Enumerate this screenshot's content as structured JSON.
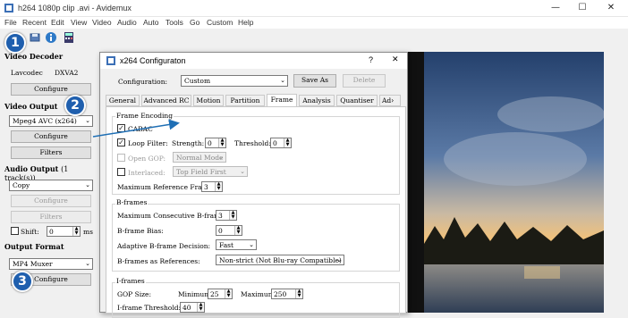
{
  "window": {
    "title": "h264 1080p clip .avi - Avidemux",
    "min": "—",
    "max": "☐",
    "close": "✕"
  },
  "menu": [
    "File",
    "Recent",
    "Edit",
    "View",
    "Video",
    "Audio",
    "Auto",
    "Tools",
    "Go",
    "Custom",
    "Help"
  ],
  "left": {
    "video_decoder": {
      "title": "Video Decoder",
      "codec_label": "Lavcodec",
      "codec_value": "DXVA2",
      "configure": "Configure"
    },
    "video_output": {
      "title": "Video Output",
      "codec": "Mpeg4 AVC (x264)",
      "configure": "Configure",
      "filters": "Filters"
    },
    "audio_output": {
      "title": "Audio Output",
      "tracks": "(1 track(s))",
      "codec": "Copy",
      "configure": "Configure",
      "filters": "Filters",
      "shift_label": "Shift:",
      "shift_value": "0",
      "shift_unit": "ms"
    },
    "output_format": {
      "title": "Output Format",
      "muxer": "MP4 Muxer",
      "configure": "Configure"
    }
  },
  "badges": [
    "1",
    "2",
    "3"
  ],
  "dialog": {
    "title": "x264 Configuraton",
    "help": "?",
    "close": "✕",
    "config_label": "Configuration:",
    "config_value": "Custom",
    "save_as": "Save As",
    "delete": "Delete",
    "tabs": [
      "General",
      "Advanced RC",
      "Motion",
      "Partition",
      "Frame",
      "Analysis",
      "Quantiser",
      "Ad"
    ],
    "active_tab": "Frame",
    "frame_encoding": {
      "title": "Frame Encoding",
      "cabac": "CABAC",
      "loop_filter": "Loop Filter:",
      "strength_label": "Strength:",
      "strength_value": "0",
      "threshold_label": "Threshold:",
      "threshold_value": "0",
      "open_gop": "Open GOP:",
      "open_gop_value": "Normal Mode",
      "interlaced": "Interlaced:",
      "interlaced_value": "Top Field First",
      "max_ref_label": "Maximum Reference Frames:",
      "max_ref_value": "3"
    },
    "bframes": {
      "title": "B-frames",
      "max_consec_label": "Maximum Consecutive B-frames:",
      "max_consec_value": "3",
      "bias_label": "B-frame Bias:",
      "bias_value": "0",
      "adaptive_label": "Adaptive B-frame Decision:",
      "adaptive_value": "Fast",
      "refs_label": "B-frames as References:",
      "refs_value": "Non-strict (Not Blu-ray Compatible)"
    },
    "iframes": {
      "title": "I-frames",
      "gop_label": "GOP Size:",
      "min_label": "Minimum:",
      "min_value": "25",
      "max_label": "Maximum:",
      "max_value": "250",
      "threshold_label": "I-frame Threshold:",
      "threshold_value": "40"
    }
  },
  "colors": {
    "badge": "#1f5fae",
    "arrow": "#1f6fb5",
    "sky_top": "#2c4a78",
    "sunset": "#f2c27a"
  }
}
